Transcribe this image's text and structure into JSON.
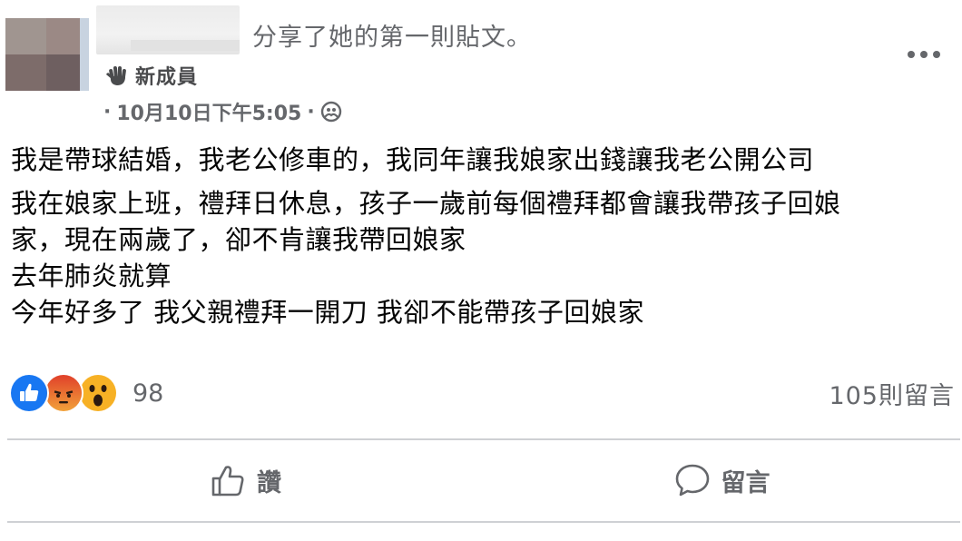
{
  "header": {
    "action_text": "分享了她的第一則貼文。",
    "badge_label": "新成員",
    "badge_icon": "waving-hand-icon",
    "timestamp": "10月10日下午5:05",
    "separator": "·",
    "audience_icon": "group-icon",
    "more_icon": "more-options-icon"
  },
  "body": {
    "paragraph1": "我是帶球結婚，我老公修車的，我同年讓我娘家出錢讓我老公開公司",
    "lines": [
      "我在娘家上班，禮拜日休息，孩子一歲前每個禮拜都會讓我帶孩子回娘",
      "家，現在兩歲了，卻不肯讓我帶回娘家",
      "去年肺炎就算",
      "今年好多了 我父親禮拜一開刀 我卻不能帶孩子回娘家"
    ]
  },
  "reactions": {
    "types": [
      "like",
      "angry",
      "wow"
    ],
    "count": "98",
    "colors": {
      "like": "#1877f2",
      "angry": "#e9710f",
      "wow": "#f7b125"
    }
  },
  "comments": {
    "count_label": "105則留言"
  },
  "actions": {
    "like_label": "讚",
    "comment_label": "留言"
  }
}
